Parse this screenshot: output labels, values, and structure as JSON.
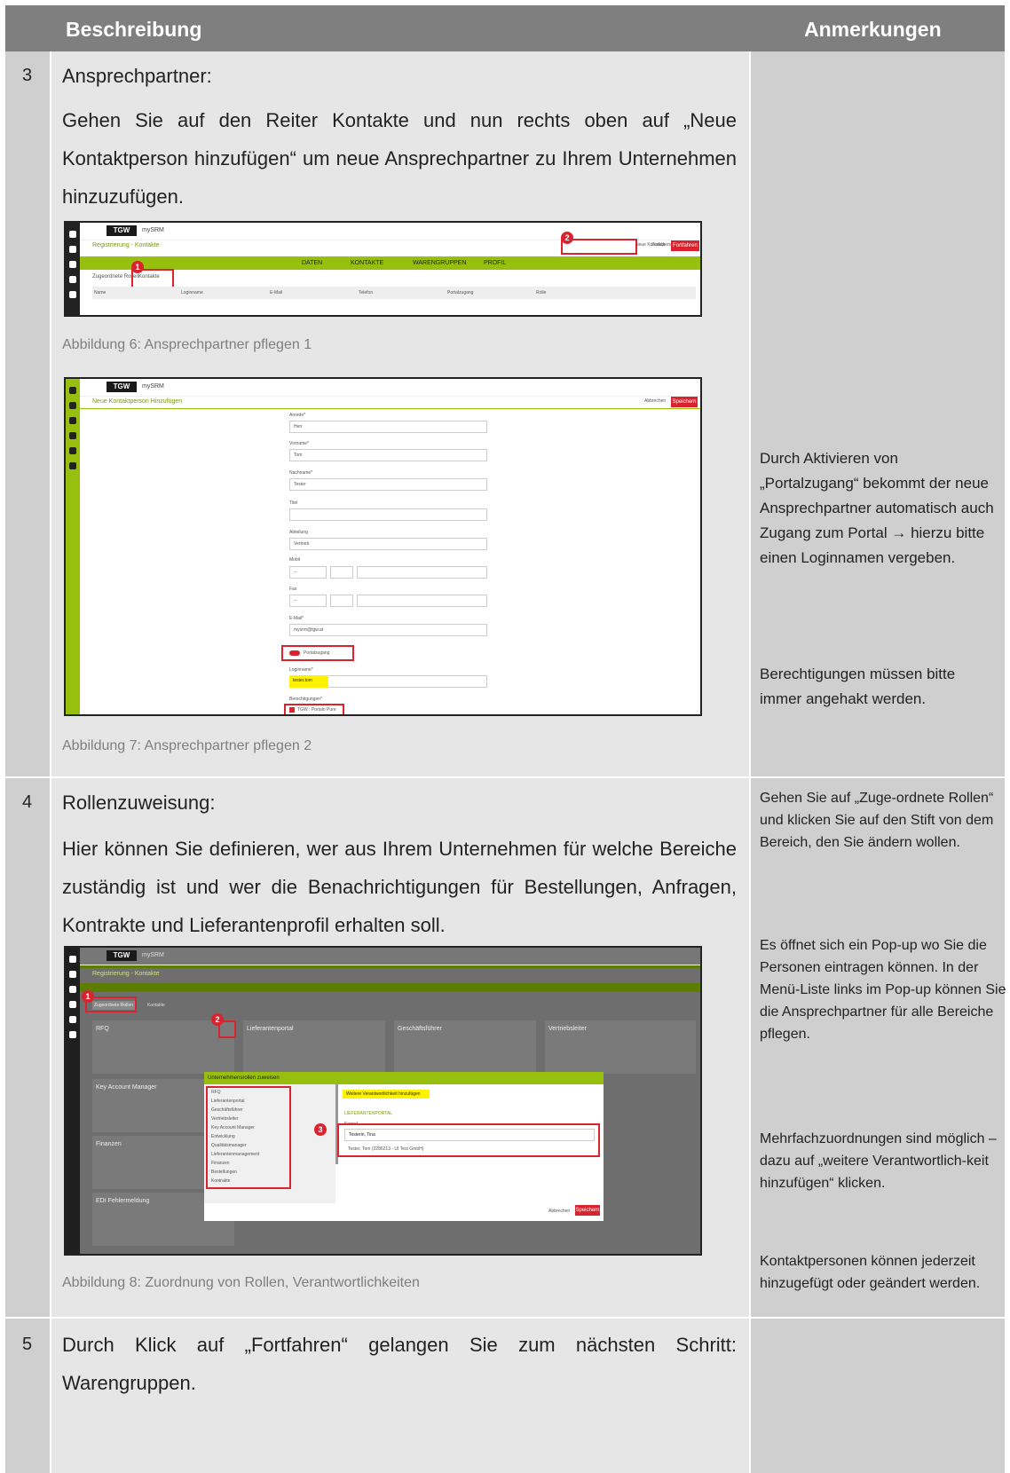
{
  "header": {
    "col_description": "Beschreibung",
    "col_notes": "Anmerkungen"
  },
  "rows": [
    {
      "number": "3",
      "title": "Ansprechpartner:",
      "text": "Gehen Sie auf den Reiter Kontakte und nun rechts oben auf „Neue Kontaktperson hinzufügen“ um neue Ansprechpartner zu Ihrem Unternehmen hinzuzufügen.",
      "fig1_caption": "Abbildung 6: Ansprechpartner pflegen 1",
      "fig2_caption": "Abbildung 7: Ansprechpartner pflegen 2",
      "note_a": "Durch Aktivieren von „Portalzugang“ bekommt der neue Ansprechpartner automatisch auch Zugang zum Portal → hierzu bitte einen Loginnamen vergeben.",
      "note_b": "Berechtigungen müssen bitte immer angehakt werden."
    },
    {
      "number": "4",
      "title": "Rollenzuweisung:",
      "text": "Hier können Sie definieren, wer aus Ihrem Unternehmen für welche Bereiche zuständig ist und wer die Benachrichtigungen für Bestellungen, Anfragen, Kontrakte und Lieferantenprofil erhalten soll.",
      "fig_caption": "Abbildung 8: Zuordnung von Rollen, Verantwortlichkeiten",
      "note_a": "Gehen Sie auf „Zuge-ordnete Rollen“ und klicken Sie auf den Stift von dem Bereich, den Sie ändern wollen.",
      "note_b": "Es öffnet sich ein Pop-up wo Sie die Personen eintragen können. In der Menü-Liste links im Pop-up können Sie die Ansprechpartner für alle Bereiche pflegen.",
      "note_c": "Mehrfachzuordnungen sind möglich – dazu auf „weitere Verantwortlich-keit hinzufügen“ klicken.",
      "note_d": "Kontaktpersonen können jederzeit hinzugefügt oder geändert werden."
    },
    {
      "number": "5",
      "text": "Durch Klick auf „Fortfahren“ gelangen Sie zum nächsten Schritt: Warengruppen."
    }
  ],
  "shot1": {
    "logo": "TGW",
    "app": "mySRM",
    "page": "Registrierung - Kontakte",
    "new_btn": "Neue Kontaktperson hinzufügen",
    "back": "Zurück",
    "next": "Fortfahren",
    "steps": [
      "DATEN",
      "KONTAKTE",
      "WARENGRUPPEN",
      "PROFIL"
    ],
    "tabs": [
      "Zugeordnete Rollen",
      "Kontakte"
    ],
    "cols": [
      "Name",
      "Loginname",
      "E-Mail",
      "Telefon",
      "Portalzugang",
      "Rolle"
    ]
  },
  "shot2": {
    "logo": "TGW",
    "app": "mySRM",
    "page": "Neue Kontaktperson Hinzufügen",
    "cancel": "Abbrechen",
    "save": "Speichern",
    "fields": [
      {
        "label": "Anrede*",
        "value": "Herr"
      },
      {
        "label": "Vorname*",
        "value": "Tom"
      },
      {
        "label": "Nachname*",
        "value": "Tester"
      },
      {
        "label": "Titel",
        "value": ""
      },
      {
        "label": "Abteilung",
        "value": "Vertrieb"
      },
      {
        "label": "Mobil",
        "value": "--"
      },
      {
        "label": "Fax",
        "value": "--"
      },
      {
        "label": "E-Mail*",
        "value": "mysrm@tgw.at"
      }
    ],
    "portal": "Portalzugang",
    "login_label": "Loginname*",
    "login_value": "tester.tom",
    "perm_label": "Berechtigungen*",
    "perm_value": "TGW : Portalo Pure"
  },
  "shot3": {
    "logo": "TGW",
    "app": "mySRM",
    "page": "Registrierung - Kontakte",
    "tabs": [
      "Zugeordnete Rollen",
      "Kontakte"
    ],
    "cards": [
      "RFQ",
      "Lieferantenportal",
      "Geschäftsführer",
      "Vertriebsleiter",
      "Key Account Manager",
      "Finanzen",
      "EDI Fehlermeldung"
    ],
    "dialog_title": "Unternehmensrollen zuweisen",
    "menu": [
      "RFQ",
      "Lieferantenportal",
      "Geschäftsführer",
      "Vertriebsleiter",
      "Key Account Manager",
      "Entwicklung",
      "Qualitätsmanager",
      "Lieferantenmanagement",
      "Finanzen",
      "Bestellungen",
      "Kontrakte"
    ],
    "add_more": "Weitere Verantwortlichkeit hinzufügen",
    "section": "LIEFERANTENPORTAL",
    "name_label": "Name*",
    "name_value": "Testerin, Tina",
    "suggestion": "Tester, Tom (2286213 - UI Test GmbH)",
    "cancel": "Abbrechen",
    "save": "Speichern"
  }
}
